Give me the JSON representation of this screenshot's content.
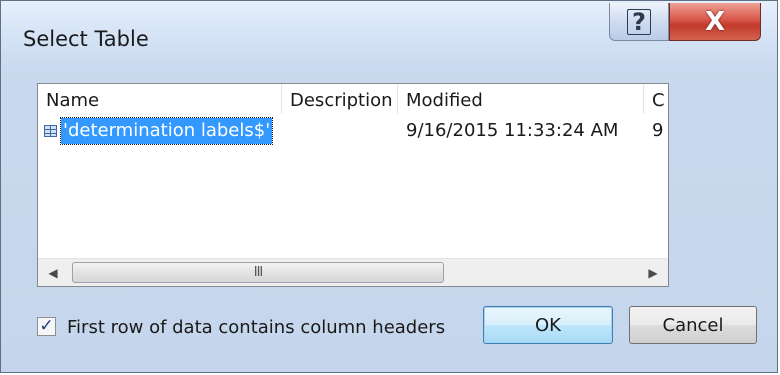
{
  "window": {
    "title": "Select Table",
    "help_label": "?",
    "close_label": "X"
  },
  "table": {
    "columns": [
      "Name",
      "Description",
      "Modified",
      "C"
    ],
    "rows": [
      {
        "name": "'determination labels$'",
        "description": "",
        "modified": "9/16/2015 11:33:24 AM",
        "c": "9",
        "selected": true
      }
    ],
    "scrollbar": {
      "left_arrow": "◀",
      "thumb_grip": "III",
      "right_arrow": "▶"
    }
  },
  "options": {
    "headers_checkbox_label": "First row of data contains column headers",
    "headers_checked": true,
    "check_glyph": "✓"
  },
  "buttons": {
    "ok_label": "OK",
    "cancel_label": "Cancel"
  },
  "colors": {
    "selection": "#3399ff",
    "close_button": "#c23a2c",
    "ok_button_border": "#3c7fb1"
  }
}
